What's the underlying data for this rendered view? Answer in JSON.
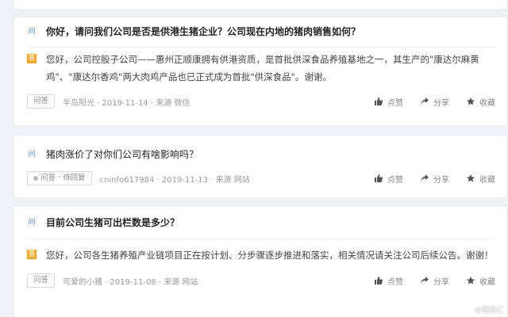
{
  "labels": {
    "q_badge": "问",
    "a_badge": "答",
    "like": "点赞",
    "share": "分享",
    "collect": "收藏"
  },
  "cards": [
    {
      "question": "你好，请问我们公司是否是供港生猪企业？公司现在内地的猪肉销售如何？",
      "answer": "您好，公司控股子公司——惠州正顺康拥有供港资质，是首批供深食品养殖基地之一，其生产的\"康达尔麻黄鸡\"、\"康达尔香鸡\"两大肉鸡产品也已正式成为首批\"供深食品\"。谢谢。",
      "tag": "问答",
      "meta": "半岛阳光 · 2019-11-14 · 来源 微信"
    },
    {
      "question": "猪肉涨价了对你们公司有啥影响吗？",
      "tag": "问答 · 待回复",
      "meta": "cninfo617984 · 2019-11-13 · 来源 网站"
    },
    {
      "question": "目前公司生猪可出栏数是多少？",
      "answer": "您好，公司各生猪养殖产业链项目正在按计划、分步骤逐步推进和落实，相关情况请关注公司后续公告。谢谢！",
      "tag": "问答",
      "meta": "可爱的小猪 · 2019-11-08 · 来源 网站"
    }
  ],
  "watermark": "@格隆汇",
  "colors": {
    "page_bg": "#eef0f3",
    "question_badge": "#4a7fd4",
    "answer_badge": "#f5a623"
  }
}
